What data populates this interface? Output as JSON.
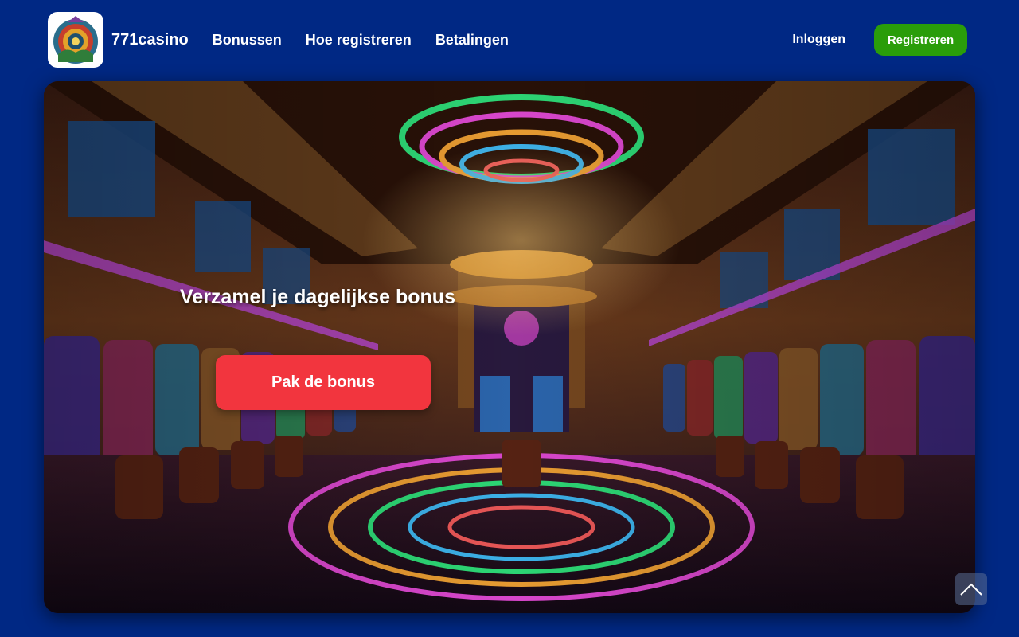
{
  "header": {
    "brand": "771casino",
    "nav": [
      {
        "label": "Bonussen"
      },
      {
        "label": "Hoe registreren"
      },
      {
        "label": "Betalingen"
      }
    ],
    "login_label": "Inloggen",
    "register_label": "Registreren"
  },
  "hero": {
    "title": "Verzamel je dagelijkse bonus",
    "cta_label": "Pak de bonus"
  },
  "colors": {
    "page_background": "#002884",
    "register_button": "#2a9d0a",
    "cta_button": "#f2353e"
  },
  "icons": {
    "logo": "casino-logo-icon",
    "scroll_top": "chevron-up-icon",
    "hero_image": "casino-interior-image"
  }
}
